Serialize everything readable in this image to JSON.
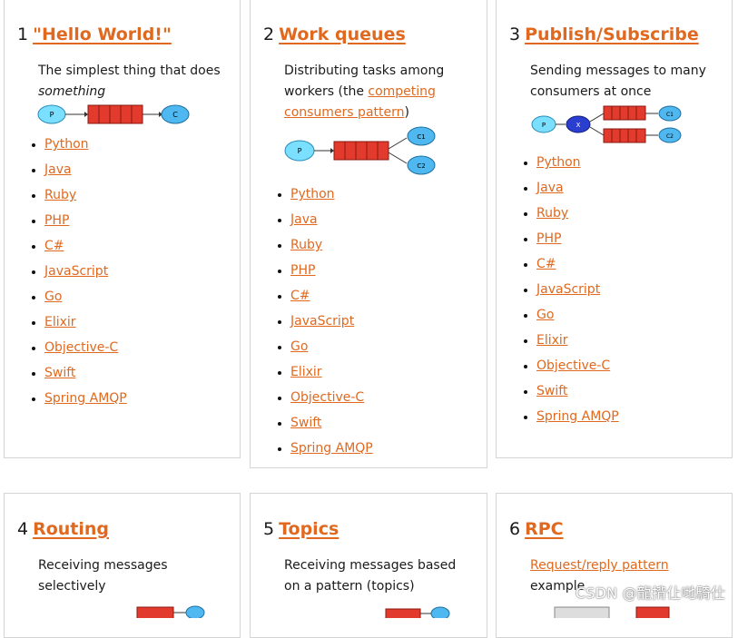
{
  "tutorials": [
    {
      "number": "1",
      "title": "\"Hello World!\"",
      "description": "The simplest thing that does",
      "description_em": "something"
    },
    {
      "number": "2",
      "title": "Work queues",
      "description_pre": "Distributing tasks among workers (the ",
      "description_link": "competing consumers pattern",
      "description_post": ")"
    },
    {
      "number": "3",
      "title": "Publish/Subscribe",
      "description": "Sending messages to many consumers at once"
    },
    {
      "number": "4",
      "title": "Routing",
      "description": "Receiving messages selectively"
    },
    {
      "number": "5",
      "title": "Topics",
      "description": "Receiving messages based on a pattern (topics)"
    },
    {
      "number": "6",
      "title": "RPC",
      "description_link": "Request/reply pattern",
      "description_post": "example"
    }
  ],
  "languages": [
    "Python",
    "Java",
    "Ruby",
    "PHP",
    "C#",
    "JavaScript",
    "Go",
    "Elixir",
    "Objective-C",
    "Swift",
    "Spring AMQP"
  ],
  "diagram_labels": {
    "producer": "P",
    "consumer": "C",
    "c1": "C1",
    "c2": "C2",
    "exchange": "X"
  },
  "colors": {
    "accent": "#e0691f",
    "queue": "#e23a2c",
    "producer": "#7be0ff",
    "consumer": "#4fb8f0",
    "exchange": "#2a3fcf"
  },
  "watermark": "CSDN @龍揹仩哋騎仕"
}
